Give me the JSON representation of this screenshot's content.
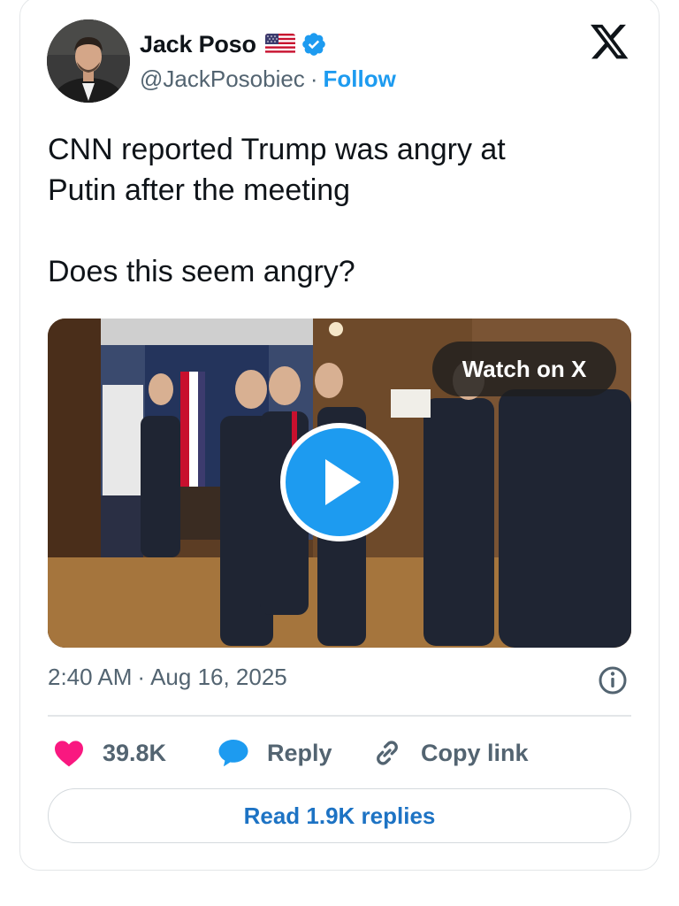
{
  "author": {
    "display_name": "Jack Poso",
    "handle": "@JackPosobiec",
    "separator": "·",
    "follow_label": "Follow",
    "flag_icon": "us-flag-icon",
    "verified_icon": "verified-badge-icon"
  },
  "brand": {
    "logo_icon": "x-logo-icon"
  },
  "tweet": {
    "text": "CNN reported Trump was angry at\nPutin after the meeting\n\nDoes this seem angry?"
  },
  "media": {
    "watch_label": "Watch on X",
    "play_icon": "play-icon"
  },
  "meta": {
    "time": "2:40 AM",
    "separator": "·",
    "date": "Aug 16, 2025",
    "info_icon": "info-icon"
  },
  "actions": {
    "likes_count": "39.8K",
    "reply_label": "Reply",
    "copy_link_label": "Copy link"
  },
  "footer": {
    "read_replies_label": "Read 1.9K replies"
  },
  "colors": {
    "accent": "#1d9bf0",
    "like": "#f91880",
    "text": "#0f1419",
    "muted": "#536471"
  }
}
